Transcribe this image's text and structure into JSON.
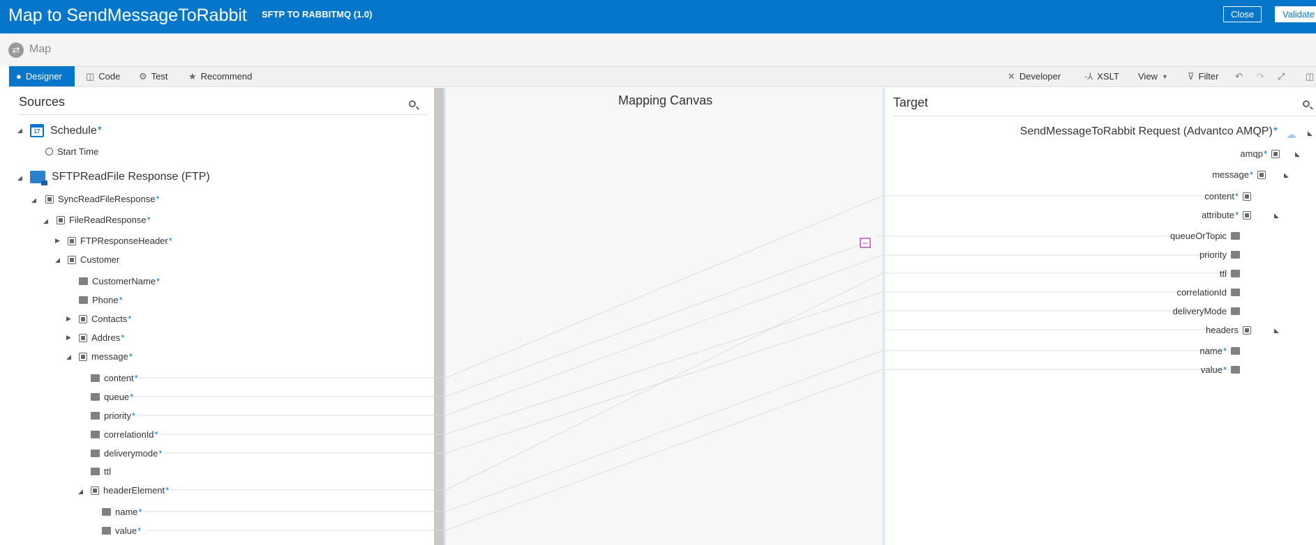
{
  "header": {
    "title": "Map to SendMessageToRabbit",
    "subtitle": "SFTP TO RABBITMQ (1.0)",
    "close_label": "Close",
    "validate_label": "Validate"
  },
  "breadcrumb": {
    "label": "Map"
  },
  "toolbar": {
    "designer": "Designer",
    "code": "Code",
    "test": "Test",
    "recommend": "Recommend",
    "developer": "Developer",
    "xslt": "XSLT",
    "view": "View",
    "filter": "Filter"
  },
  "sources": {
    "title": "Sources",
    "schedule": "Schedule",
    "start_time": "Start Time",
    "sftp_response": "SFTPReadFile Response (FTP)",
    "sync_read": "SyncReadFileResponse",
    "file_read": "FileReadResponse",
    "ftp_header": "FTPResponseHeader",
    "customer": "Customer",
    "customer_name": "CustomerName",
    "phone": "Phone",
    "contacts": "Contacts",
    "addres": "Addres",
    "message": "message",
    "content": "content",
    "queue": "queue",
    "priority": "priority",
    "correlation_id": "correlationId",
    "delivery_mode": "deliverymode",
    "ttl": "ttl",
    "header_element": "headerElement",
    "name": "name",
    "value": "value",
    "required_marker": "*"
  },
  "canvas": {
    "title": "Mapping Canvas"
  },
  "target": {
    "title": "Target",
    "request": "SendMessageToRabbit Request (Advantco AMQP)",
    "amqp": "amqp",
    "message": "message",
    "content": "content",
    "attribute": "attribute",
    "queue_or_topic": "queueOrTopic",
    "priority": "priority",
    "ttl": "ttl",
    "correlation_id": "correlationId",
    "delivery_mode": "deliveryMode",
    "headers": "headers",
    "name": "name",
    "value": "value",
    "required_marker": "*"
  },
  "colors": {
    "brand": "#0576c9",
    "canvas_bg": "#f7f7f7",
    "scrollbar": "#c8c8c8"
  }
}
